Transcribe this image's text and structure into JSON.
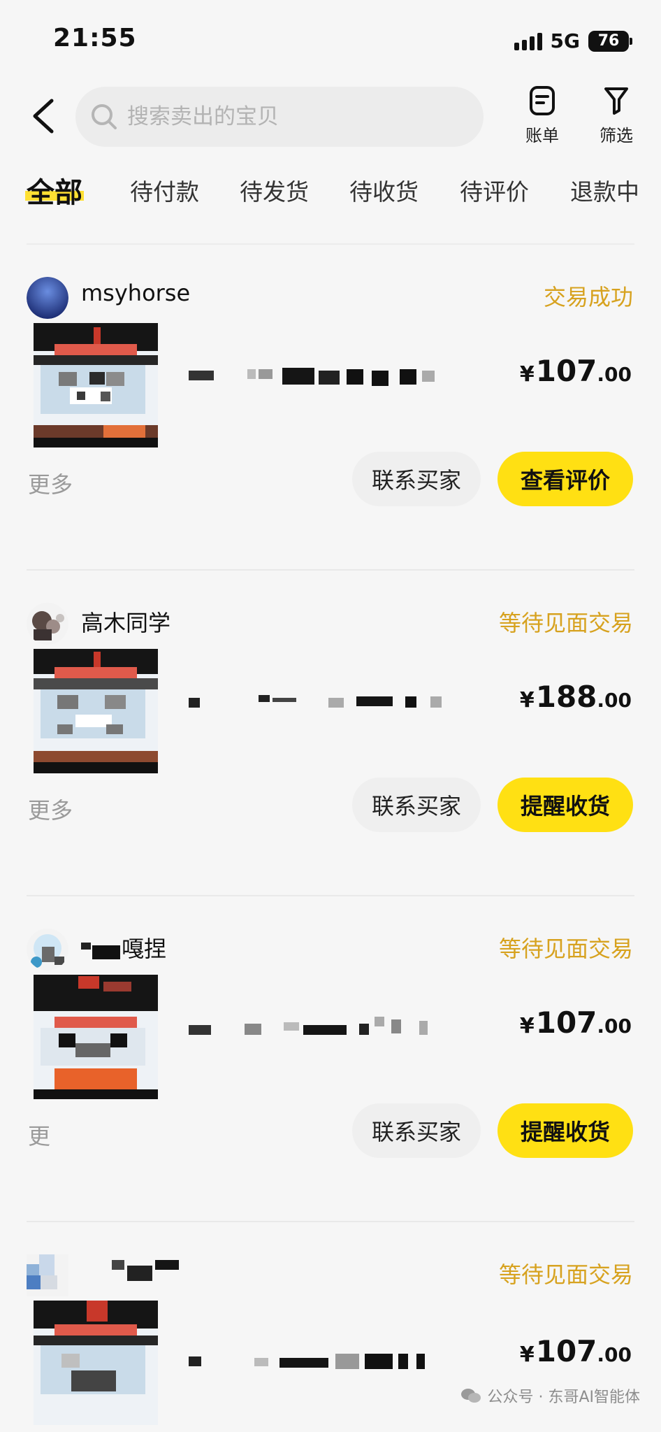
{
  "status_bar": {
    "time": "21:55",
    "network": "5G",
    "battery": "76"
  },
  "header": {
    "search_placeholder": "搜索卖出的宝贝",
    "bill_label": "账单",
    "filter_label": "筛选"
  },
  "tabs": [
    {
      "label": "全部",
      "active": true
    },
    {
      "label": "待付款"
    },
    {
      "label": "待发货"
    },
    {
      "label": "待收货"
    },
    {
      "label": "待评价"
    },
    {
      "label": "退款中"
    }
  ],
  "orders": [
    {
      "buyer": "msyhorse",
      "status": "交易成功",
      "price_int": "107",
      "price_dec": ".00",
      "more": "更多",
      "contact": "联系买家",
      "action": "查看评价"
    },
    {
      "buyer": "高木同学",
      "status": "等待见面交易",
      "price_int": "188",
      "price_dec": ".00",
      "more": "更多",
      "contact": "联系买家",
      "action": "提醒收货"
    },
    {
      "buyer": "嘎捏",
      "status": "等待见面交易",
      "price_int": "107",
      "price_dec": ".00",
      "more": "更",
      "contact": "联系买家",
      "action": "提醒收货"
    },
    {
      "buyer": "",
      "status": "等待见面交易",
      "price_int": "107",
      "price_dec": ".00"
    }
  ],
  "currency_symbol": "¥",
  "watermark": "公众号 · 东哥AI智能体",
  "colors": {
    "accent": "#ffe013",
    "status": "#d7a21f",
    "muted": "#9a9a9a"
  }
}
